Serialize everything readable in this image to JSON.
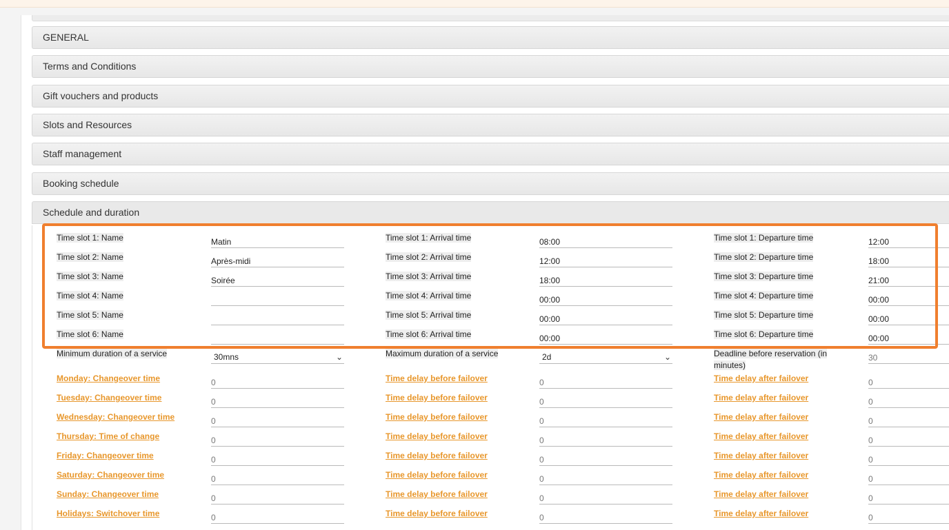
{
  "accordion": [
    {
      "label": "GENERAL"
    },
    {
      "label": "Terms and Conditions"
    },
    {
      "label": "Gift vouchers and products"
    },
    {
      "label": "Slots and Resources"
    },
    {
      "label": "Staff management"
    },
    {
      "label": "Booking schedule"
    },
    {
      "label": "Schedule and duration"
    }
  ],
  "timeslots": [
    {
      "name_label": "Time slot 1: Name",
      "name": "Matin",
      "arrival_label": "Time slot 1: Arrival time",
      "arrival": "08:00",
      "departure_label": "Time slot 1: Departure time",
      "departure": "12:00"
    },
    {
      "name_label": "Time slot 2: Name",
      "name": "Après-midi",
      "arrival_label": "Time slot 2: Arrival time",
      "arrival": "12:00",
      "departure_label": "Time slot 2: Departure time",
      "departure": "18:00"
    },
    {
      "name_label": "Time slot 3: Name",
      "name": "Soirée",
      "arrival_label": "Time slot 3: Arrival time",
      "arrival": "18:00",
      "departure_label": "Time slot 3: Departure time",
      "departure": "21:00"
    },
    {
      "name_label": "Time slot 4: Name",
      "name": "",
      "arrival_label": "Time slot 4: Arrival time",
      "arrival": "00:00",
      "departure_label": "Time slot 4: Departure time",
      "departure": "00:00"
    },
    {
      "name_label": "Time slot 5: Name",
      "name": "",
      "arrival_label": "Time slot 5: Arrival time",
      "arrival": "00:00",
      "departure_label": "Time slot 5: Departure time",
      "departure": "00:00"
    },
    {
      "name_label": "Time slot 6: Name",
      "name": "",
      "arrival_label": "Time slot 6: Arrival time",
      "arrival": "00:00",
      "departure_label": "Time slot 6: Departure time",
      "departure": "00:00"
    }
  ],
  "durations": {
    "min_label": "Minimum duration of a service",
    "min_value": "30mns",
    "max_label": "Maximum duration of a service",
    "max_value": "2d",
    "deadline_label_1": "Deadline before reservation (in",
    "deadline_label_2": "minutes)",
    "deadline_value": "30"
  },
  "changeovers": [
    {
      "day_label": "Monday: Changeover time",
      "day_value": "0",
      "before_label": "Time delay before failover",
      "before_value": "0",
      "after_label": "Time delay after failover",
      "after_value": "0"
    },
    {
      "day_label": "Tuesday: Changeover time",
      "day_value": "0",
      "before_label": "Time delay before failover",
      "before_value": "0",
      "after_label": "Time delay after failover",
      "after_value": "0"
    },
    {
      "day_label": "Wednesday: Changeover time",
      "day_value": "0",
      "before_label": "Time delay before failover",
      "before_value": "0",
      "after_label": "Time delay after failover",
      "after_value": "0"
    },
    {
      "day_label": "Thursday: Time of change",
      "day_value": "0",
      "before_label": "Time delay before failover",
      "before_value": "0",
      "after_label": "Time delay after failover",
      "after_value": "0"
    },
    {
      "day_label": "Friday: Changeover time",
      "day_value": "0",
      "before_label": "Time delay before failover",
      "before_value": "0",
      "after_label": "Time delay after failover",
      "after_value": "0"
    },
    {
      "day_label": "Saturday: Changeover time",
      "day_value": "0",
      "before_label": "Time delay before failover",
      "before_value": "0",
      "after_label": "Time delay after failover",
      "after_value": "0"
    },
    {
      "day_label": "Sunday: Changeover time",
      "day_value": "0",
      "before_label": "Time delay before failover",
      "before_value": "0",
      "after_label": "Time delay after failover",
      "after_value": "0"
    },
    {
      "day_label": "Holidays: Switchover time",
      "day_value": "0",
      "before_label": "Time delay before failover",
      "before_value": "0",
      "after_label": "Time delay after failover",
      "after_value": "0"
    }
  ],
  "colors": {
    "accent": "#e8972c",
    "highlight": "#f07f2e"
  }
}
